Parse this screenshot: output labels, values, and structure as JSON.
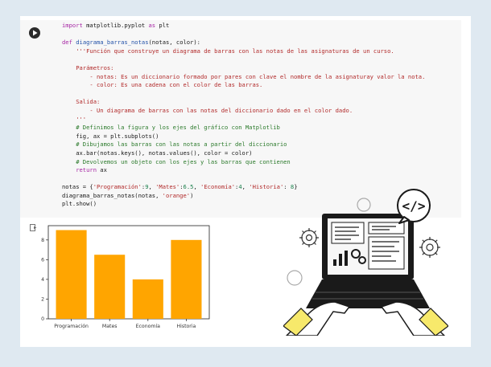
{
  "code_cell": {
    "run_icon": "play-icon",
    "lines": [
      [
        {
          "t": "import",
          "c": "kw"
        },
        {
          "t": " matplotlib.pyplot "
        },
        {
          "t": "as",
          "c": "kw"
        },
        {
          "t": " plt"
        }
      ],
      [],
      [
        {
          "t": "def",
          "c": "kw"
        },
        {
          "t": " "
        },
        {
          "t": "diagrama_barras_notas",
          "c": "fn"
        },
        {
          "t": "(notas, color):"
        }
      ],
      [
        {
          "t": "    '''Función que construye un diagrama de barras con las notas de las asignaturas de un curso.",
          "c": "str"
        }
      ],
      [],
      [
        {
          "t": "    Parámetros:",
          "c": "str"
        }
      ],
      [
        {
          "t": "        - notas: Es un diccionario formado por pares con clave el nombre de la asignaturay valor la nota.",
          "c": "str"
        }
      ],
      [
        {
          "t": "        - color: Es una cadena con el color de las barras.",
          "c": "str"
        }
      ],
      [],
      [
        {
          "t": "    Salida:",
          "c": "str"
        }
      ],
      [
        {
          "t": "        - Un diagrama de barras con las notas del diccionario dado en el color dado.",
          "c": "str"
        }
      ],
      [
        {
          "t": "    '''",
          "c": "str"
        }
      ],
      [
        {
          "t": "    # Definimos la figura y los ejes del gráfico con Matplotlib",
          "c": "cm"
        }
      ],
      [
        {
          "t": "    fig, ax = plt.subplots()"
        }
      ],
      [
        {
          "t": "    # Dibujamos las barras con las notas a partir del diccionario",
          "c": "cm"
        }
      ],
      [
        {
          "t": "    ax.bar(notas.keys(), notas.values(), color = color)"
        }
      ],
      [
        {
          "t": "    # Devolvemos un objeto con los ejes y las barras que contienen",
          "c": "cm"
        }
      ],
      [
        {
          "t": "    "
        },
        {
          "t": "return",
          "c": "kw"
        },
        {
          "t": " ax"
        }
      ],
      [],
      [
        {
          "t": "notas = {"
        },
        {
          "t": "'Programación'",
          "c": "str"
        },
        {
          "t": ":"
        },
        {
          "t": "9",
          "c": "num"
        },
        {
          "t": ", "
        },
        {
          "t": "'Mates'",
          "c": "str"
        },
        {
          "t": ":"
        },
        {
          "t": "6.5",
          "c": "num"
        },
        {
          "t": ", "
        },
        {
          "t": "'Economía'",
          "c": "str"
        },
        {
          "t": ":"
        },
        {
          "t": "4",
          "c": "num"
        },
        {
          "t": ", "
        },
        {
          "t": "'Historia'",
          "c": "str"
        },
        {
          "t": ": "
        },
        {
          "t": "8",
          "c": "num"
        },
        {
          "t": "}"
        }
      ],
      [
        {
          "t": "diagrama_barras_notas(notas, "
        },
        {
          "t": "'orange'",
          "c": "str"
        },
        {
          "t": ")"
        }
      ],
      [
        {
          "t": "plt.show()"
        }
      ]
    ]
  },
  "output_icon": "output-icon",
  "chart_data": {
    "type": "bar",
    "categories": [
      "Programación",
      "Mates",
      "Economía",
      "Historia"
    ],
    "values": [
      9,
      6.5,
      4,
      8
    ],
    "color": "#ffa500",
    "ylim": [
      0,
      9.45
    ],
    "yticks": [
      0,
      2,
      4,
      6,
      8
    ],
    "title": "",
    "xlabel": "",
    "ylabel": "",
    "grid": false
  },
  "illustration": {
    "code_tag": "</>",
    "accent": "#1a1a1a",
    "highlight": "#f7e96b"
  }
}
